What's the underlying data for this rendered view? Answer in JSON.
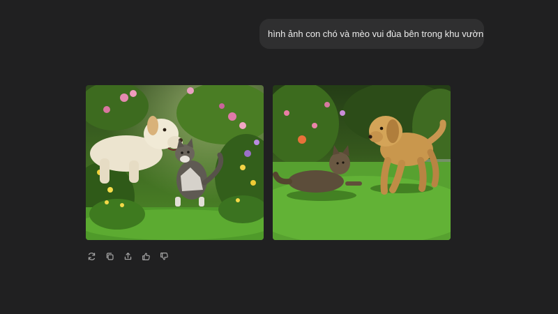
{
  "conversation": {
    "user_message": "hình ảnh con chó và mèo vui đùa bên trong khu vườn"
  },
  "response": {
    "images": [
      {
        "icon": "dog-and-kitten-garden-image"
      },
      {
        "icon": "dog-and-cat-lawn-image"
      }
    ],
    "actions": [
      {
        "icon": "regenerate-icon"
      },
      {
        "icon": "copy-icon"
      },
      {
        "icon": "share-icon"
      },
      {
        "icon": "thumbs-up-icon"
      },
      {
        "icon": "thumbs-down-icon"
      }
    ]
  },
  "colors": {
    "background": "#202021",
    "bubble": "#2f2f30",
    "icon": "#a8a8a8"
  }
}
